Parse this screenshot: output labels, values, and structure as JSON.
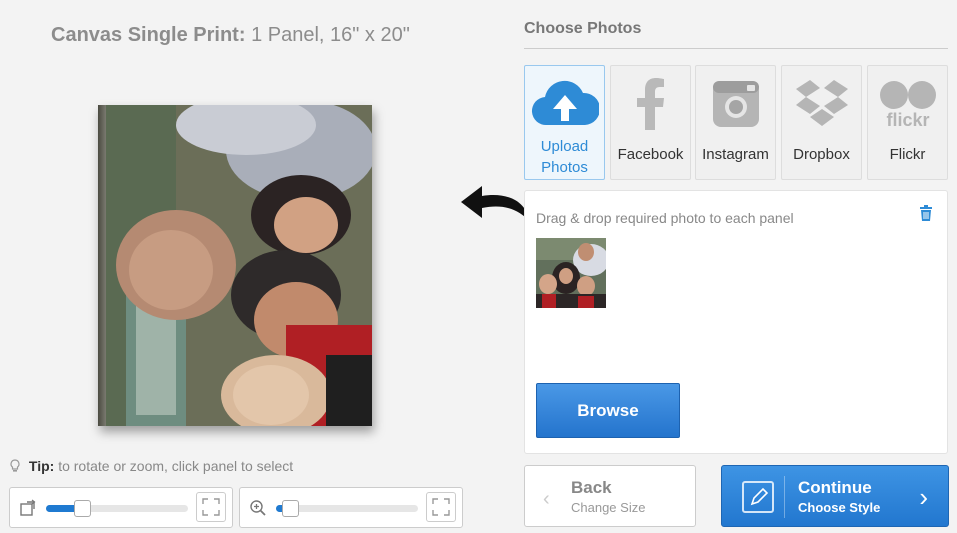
{
  "product": {
    "title_bold": "Canvas Single Print:",
    "title_rest": "1 Panel, 16\" x 20\""
  },
  "tip": {
    "label": "Tip:",
    "text": "to rotate or zoom, click panel to select"
  },
  "sliders": {
    "rotate_level": 0.25,
    "zoom_level": 0.1
  },
  "choose": {
    "title": "Choose Photos",
    "sources": [
      {
        "line1": "Upload",
        "line2": "Photos",
        "icon": "cloud-upload-icon"
      },
      {
        "label": "Facebook",
        "icon": "facebook-icon"
      },
      {
        "label": "Instagram",
        "icon": "instagram-icon"
      },
      {
        "label": "Dropbox",
        "icon": "dropbox-icon"
      },
      {
        "label": "Flickr",
        "icon": "flickr-icon",
        "logo_text": "flickr"
      }
    ],
    "drop_hint": "Drag & drop required photo to each panel",
    "browse_label": "Browse"
  },
  "nav": {
    "back_title": "Back",
    "back_sub": "Change Size",
    "continue_title": "Continue",
    "continue_sub": "Choose Style"
  },
  "colors": {
    "accent": "#2e8bd6",
    "button_blue": "#2a7fd6"
  }
}
